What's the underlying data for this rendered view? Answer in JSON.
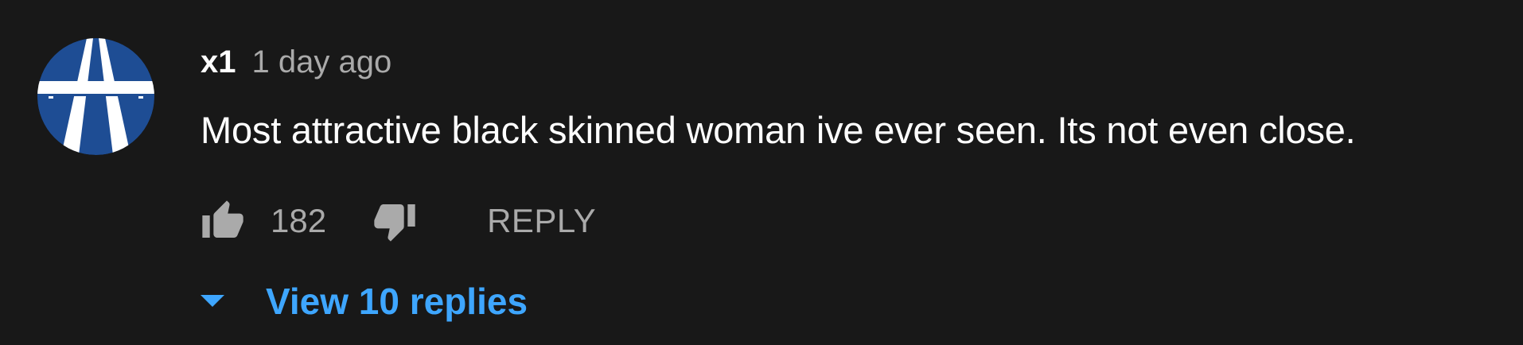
{
  "comment": {
    "author": "x1",
    "timestamp": "1 day ago",
    "text": "Most attractive black skinned woman ive ever seen. Its not even close.",
    "avatar_icon": "highway-sign-icon",
    "like_count": "182",
    "reply_label": "REPLY",
    "view_replies_label": "View 10 replies"
  },
  "colors": {
    "background": "#181818",
    "avatar_blue": "#1e4d94",
    "link_blue": "#3ea6ff",
    "secondary_text": "#aaaaaa"
  }
}
